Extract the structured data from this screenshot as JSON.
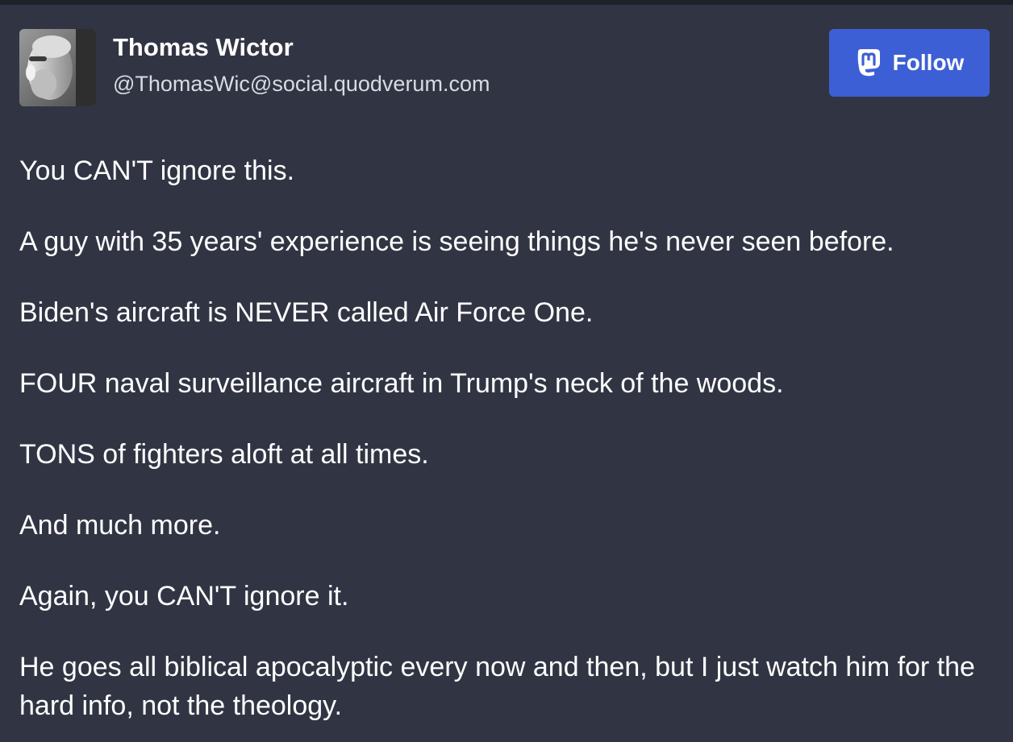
{
  "account": {
    "display_name": "Thomas Wictor",
    "handle": "@ThomasWic@social.quodverum.com",
    "avatar_icon": "profile-photo"
  },
  "follow_button": {
    "label": "Follow",
    "icon": "mastodon-logo-icon",
    "color": "#3d5fd6"
  },
  "post": {
    "paragraphs": [
      "You CAN'T ignore this.",
      "A guy with 35 years' experience is seeing things he's never seen before.",
      "Biden's aircraft is NEVER called Air Force One.",
      "FOUR naval surveillance aircraft in Trump's neck of the woods.",
      "TONS of fighters aloft at all times.",
      "And much more.",
      "Again, you CAN'T ignore it.",
      "He goes all biblical apocalyptic every now and then, but I just watch him for the hard info, not the theology."
    ]
  },
  "colors": {
    "background": "#313543",
    "text": "#ffffff",
    "secondary_text": "#d9dbe3"
  }
}
